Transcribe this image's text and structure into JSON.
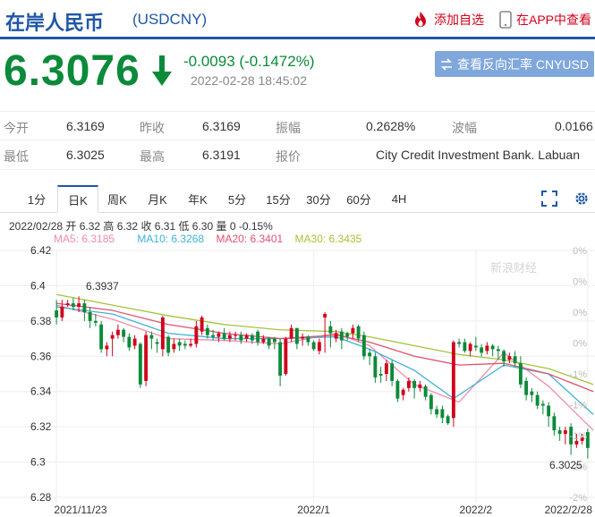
{
  "header": {
    "title": "在岸人民币",
    "code": "(USDCNY)",
    "add_favorite": "添加自选",
    "app_link": "在APP中查看"
  },
  "quote": {
    "price": "6.3076",
    "change": "-0.0093 (-0.1472%)",
    "timestamp": "2022-02-28 18:45:02",
    "reverse_button": "查看反向汇率 CNYUSD"
  },
  "stats": {
    "open_label": "今开",
    "open": "6.3169",
    "prev_close_label": "昨收",
    "prev_close": "6.3169",
    "amplitude_label": "振幅",
    "amplitude": "0.2628%",
    "range_label": "波幅",
    "range": "0.0166",
    "low_label": "最低",
    "low": "6.3025",
    "high_label": "最高",
    "high": "6.3191",
    "quote_source_label": "报价",
    "quote_source": "City Credit Investment Bank. Labuan"
  },
  "tabs": [
    "1分",
    "日K",
    "周K",
    "月K",
    "年K",
    "5分",
    "15分",
    "30分",
    "60分",
    "4H"
  ],
  "active_tab": "日K",
  "chart_info": {
    "line1": "2022/02/28 开 6.32 高 6.32 收 6.31 低 6.30 量 0 -0.15%",
    "ma5": "MA5: 6.3185",
    "ma10": "MA10: 6.3268",
    "ma20": "MA20: 6.3401",
    "ma30": "MA30: 6.3435",
    "watermark": "新浪财经"
  },
  "colors": {
    "up": "#d0021b",
    "down": "#0b8a3a",
    "ma5": "#f08caa",
    "ma10": "#3fb2d8",
    "ma20": "#e0526e",
    "ma30": "#a5c33b",
    "brand": "#1f57a5"
  },
  "chart_data": {
    "type": "candlestick",
    "ylim": [
      6.28,
      6.42
    ],
    "y_ticks": [
      "6.42",
      "6.4",
      "6.38",
      "6.36",
      "6.34",
      "6.32",
      "6.3",
      "6.28"
    ],
    "pct_ticks": [
      "0%",
      "0%",
      "0%",
      "0%",
      "-1%",
      "-1%",
      "-1%",
      "-2%",
      "-2%"
    ],
    "x_labels": [
      "2021/11/23",
      "2022/1",
      "2022/2",
      "2022/2/28"
    ],
    "annotations": {
      "high": "6.3937",
      "low": "6.3025"
    },
    "candles": [
      [
        6.386,
        6.382,
        6.392,
        6.378
      ],
      [
        6.382,
        6.388,
        6.392,
        6.38
      ],
      [
        6.389,
        6.39,
        6.392,
        6.388
      ],
      [
        6.39,
        6.388,
        6.393,
        6.386
      ],
      [
        6.388,
        6.39,
        6.394,
        6.385
      ],
      [
        6.39,
        6.385,
        6.392,
        6.38
      ],
      [
        6.385,
        6.38,
        6.388,
        6.376
      ],
      [
        6.38,
        6.379,
        6.384,
        6.377
      ],
      [
        6.378,
        6.364,
        6.38,
        6.362
      ],
      [
        6.364,
        6.366,
        6.368,
        6.36
      ],
      [
        6.37,
        6.372,
        6.374,
        6.36
      ],
      [
        6.372,
        6.375,
        6.378,
        6.37
      ],
      [
        6.375,
        6.371,
        6.376,
        6.368
      ],
      [
        6.371,
        6.365,
        6.373,
        6.363
      ],
      [
        6.366,
        6.37,
        6.372,
        6.364
      ],
      [
        6.367,
        6.344,
        6.368,
        6.342
      ],
      [
        6.346,
        6.372,
        6.374,
        6.343
      ],
      [
        6.372,
        6.37,
        6.374,
        6.364
      ],
      [
        6.368,
        6.367,
        6.37,
        6.362
      ],
      [
        6.364,
        6.382,
        6.383,
        6.36
      ],
      [
        6.371,
        6.362,
        6.372,
        6.36
      ],
      [
        6.364,
        6.367,
        6.37,
        6.362
      ],
      [
        6.368,
        6.366,
        6.37,
        6.363
      ],
      [
        6.367,
        6.366,
        6.369,
        6.364
      ],
      [
        6.366,
        6.367,
        6.37,
        6.365
      ],
      [
        6.367,
        6.377,
        6.38,
        6.365
      ],
      [
        6.374,
        6.382,
        6.383,
        6.372
      ],
      [
        6.376,
        6.372,
        6.378,
        6.37
      ],
      [
        6.372,
        6.371,
        6.375,
        6.369
      ],
      [
        6.371,
        6.373,
        6.374,
        6.368
      ],
      [
        6.373,
        6.37,
        6.376,
        6.369
      ],
      [
        6.37,
        6.372,
        6.374,
        6.368
      ],
      [
        6.372,
        6.372,
        6.374,
        6.369
      ],
      [
        6.372,
        6.369,
        6.374,
        6.367
      ],
      [
        6.37,
        6.372,
        6.373,
        6.368
      ],
      [
        6.372,
        6.369,
        6.373,
        6.367
      ],
      [
        6.374,
        6.368,
        6.375,
        6.366
      ],
      [
        6.368,
        6.37,
        6.372,
        6.367
      ],
      [
        6.37,
        6.366,
        6.371,
        6.364
      ],
      [
        6.37,
        6.368,
        6.371,
        6.364
      ],
      [
        6.368,
        6.349,
        6.37,
        6.343
      ],
      [
        6.35,
        6.37,
        6.371,
        6.349
      ],
      [
        6.37,
        6.376,
        6.378,
        6.368
      ],
      [
        6.376,
        6.367,
        6.376,
        6.364
      ],
      [
        6.37,
        6.371,
        6.373,
        6.366
      ],
      [
        6.371,
        6.368,
        6.372,
        6.366
      ],
      [
        6.368,
        6.364,
        6.369,
        6.363
      ],
      [
        6.363,
        6.368,
        6.37,
        6.361
      ],
      [
        6.382,
        6.384,
        6.385,
        6.362
      ],
      [
        6.377,
        6.373,
        6.38,
        6.365
      ],
      [
        6.37,
        6.373,
        6.375,
        6.368
      ],
      [
        6.374,
        6.369,
        6.376,
        6.364
      ],
      [
        6.373,
        6.371,
        6.374,
        6.369
      ],
      [
        6.373,
        6.376,
        6.378,
        6.37
      ],
      [
        6.377,
        6.37,
        6.378,
        6.368
      ],
      [
        6.372,
        6.36,
        6.374,
        6.358
      ],
      [
        6.362,
        6.36,
        6.364,
        6.355
      ],
      [
        6.36,
        6.348,
        6.362,
        6.345
      ],
      [
        6.35,
        6.349,
        6.354,
        6.345
      ],
      [
        6.35,
        6.356,
        6.358,
        6.346
      ],
      [
        6.356,
        6.346,
        6.358,
        6.343
      ],
      [
        6.346,
        6.336,
        6.347,
        6.334
      ],
      [
        6.338,
        6.341,
        6.342,
        6.335
      ],
      [
        6.342,
        6.346,
        6.348,
        6.34
      ],
      [
        6.346,
        6.342,
        6.347,
        6.336
      ],
      [
        6.342,
        6.344,
        6.346,
        6.34
      ],
      [
        6.343,
        6.337,
        6.344,
        6.335
      ],
      [
        6.338,
        6.33,
        6.339,
        6.327
      ],
      [
        6.33,
        6.327,
        6.332,
        6.325
      ],
      [
        6.33,
        6.325,
        6.332,
        6.322
      ],
      [
        6.326,
        6.322,
        6.327,
        6.321
      ],
      [
        6.325,
        6.368,
        6.369,
        6.32
      ],
      [
        6.368,
        6.367,
        6.37,
        6.365
      ],
      [
        6.368,
        6.363,
        6.37,
        6.362
      ],
      [
        6.363,
        6.367,
        6.368,
        6.36
      ],
      [
        6.366,
        6.365,
        6.371,
        6.363
      ],
      [
        6.365,
        6.362,
        6.367,
        6.36
      ],
      [
        6.363,
        6.366,
        6.368,
        6.361
      ],
      [
        6.366,
        6.364,
        6.367,
        6.36
      ],
      [
        6.364,
        6.363,
        6.366,
        6.358
      ],
      [
        6.363,
        6.357,
        6.364,
        6.354
      ],
      [
        6.358,
        6.36,
        6.362,
        6.356
      ],
      [
        6.36,
        6.356,
        6.363,
        6.354
      ],
      [
        6.356,
        6.344,
        6.36,
        6.342
      ],
      [
        6.346,
        6.338,
        6.348,
        6.335
      ],
      [
        6.34,
        6.338,
        6.342,
        6.334
      ],
      [
        6.338,
        6.332,
        6.34,
        6.33
      ],
      [
        6.333,
        6.332,
        6.335,
        6.327
      ],
      [
        6.332,
        6.326,
        6.334,
        6.32
      ],
      [
        6.326,
        6.318,
        6.328,
        6.315
      ],
      [
        6.318,
        6.316,
        6.32,
        6.312
      ],
      [
        6.316,
        6.318,
        6.32,
        6.31
      ],
      [
        6.32,
        6.31,
        6.322,
        6.304
      ],
      [
        6.31,
        6.312,
        6.316,
        6.308
      ],
      [
        6.312,
        6.314,
        6.316,
        6.31
      ],
      [
        6.317,
        6.308,
        6.319,
        6.302
      ]
    ],
    "ma_lines": {
      "ma5": [
        [
          0,
          6.389
        ],
        [
          10,
          6.381
        ],
        [
          20,
          6.37
        ],
        [
          30,
          6.369
        ],
        [
          40,
          6.367
        ],
        [
          50,
          6.373
        ],
        [
          56,
          6.366
        ],
        [
          64,
          6.344
        ],
        [
          72,
          6.334
        ],
        [
          80,
          6.362
        ],
        [
          88,
          6.343
        ],
        [
          96,
          6.318
        ]
      ],
      "ma10": [
        [
          0,
          6.388
        ],
        [
          10,
          6.384
        ],
        [
          20,
          6.373
        ],
        [
          30,
          6.37
        ],
        [
          40,
          6.37
        ],
        [
          50,
          6.371
        ],
        [
          56,
          6.364
        ],
        [
          64,
          6.352
        ],
        [
          71,
          6.336
        ],
        [
          80,
          6.355
        ],
        [
          88,
          6.35
        ],
        [
          96,
          6.327
        ]
      ],
      "ma20": [
        [
          0,
          6.39
        ],
        [
          10,
          6.386
        ],
        [
          20,
          6.378
        ],
        [
          30,
          6.373
        ],
        [
          40,
          6.37
        ],
        [
          50,
          6.372
        ],
        [
          56,
          6.368
        ],
        [
          64,
          6.36
        ],
        [
          72,
          6.355
        ],
        [
          80,
          6.356
        ],
        [
          88,
          6.35
        ],
        [
          96,
          6.34
        ]
      ],
      "ma30": [
        [
          0,
          6.395
        ],
        [
          10,
          6.389
        ],
        [
          20,
          6.383
        ],
        [
          30,
          6.378
        ],
        [
          40,
          6.375
        ],
        [
          50,
          6.374
        ],
        [
          56,
          6.371
        ],
        [
          64,
          6.366
        ],
        [
          72,
          6.361
        ],
        [
          80,
          6.358
        ],
        [
          88,
          6.353
        ],
        [
          96,
          6.344
        ]
      ]
    }
  }
}
